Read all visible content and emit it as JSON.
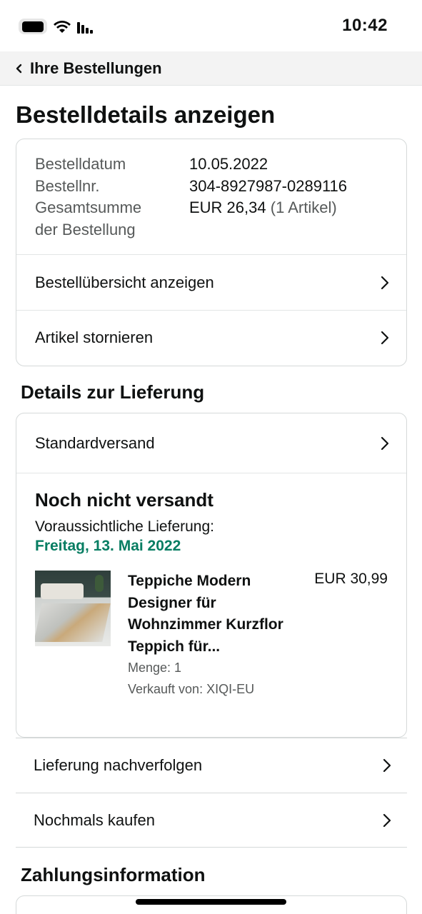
{
  "status_bar": {
    "time": "10:42",
    "icons": [
      "battery-icon",
      "wifi-icon",
      "signal-icon"
    ]
  },
  "nav": {
    "back_label": "Ihre Bestellungen"
  },
  "page": {
    "title": "Bestelldetails anzeigen"
  },
  "order": {
    "date_label": "Bestelldatum",
    "date_value": "10.05.2022",
    "number_label": "Bestellnr.",
    "number_value": "304-8927987-0289116",
    "total_label_line1": "Gesamtsumme",
    "total_label_line2": "der Bestellung",
    "total_value": "EUR 26,34",
    "total_items": "(1 Artikel)",
    "links": [
      {
        "label": "Bestellübersicht anzeigen"
      },
      {
        "label": "Artikel stornieren"
      }
    ]
  },
  "delivery": {
    "section_title": "Details zur Lieferung",
    "shipping_method": "Standardversand",
    "status_title": "Noch nicht versandt",
    "eta_label": "Voraussichtliche Lieferung:",
    "eta_date": "Freitag, 13. Mai 2022",
    "eta_color": "#067d62",
    "item": {
      "title": "Teppiche Modern Designer für Wohnzimmer Kurzflor Teppich für...",
      "price": "EUR 30,99",
      "quantity": "Menge: 1",
      "seller": "Verkauft von: XIQI-EU"
    }
  },
  "actions": [
    {
      "label": "Lieferung nachverfolgen"
    },
    {
      "label": "Nochmals kaufen"
    }
  ],
  "payment": {
    "section_title": "Zahlungsinformation"
  }
}
